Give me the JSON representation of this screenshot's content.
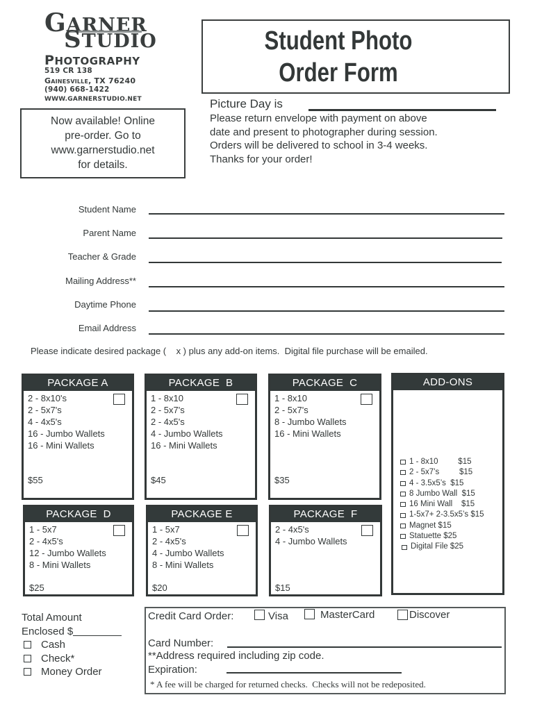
{
  "logo": {
    "line1_initial": "G",
    "line1_rest": "ARNER",
    "line2_initial": "S",
    "line2_rest": "TUDIO",
    "line3_initial": "P",
    "line3_rest": "HOTOGRAPHY",
    "address": "519 CR 138",
    "city": "Gainesville, TX 76240",
    "phone": "(940) 668-1422",
    "website": "www.garnerstudio.net"
  },
  "title": {
    "line1": "Student Photo",
    "line2": "Order Form"
  },
  "picture_day": {
    "label": "Picture Day is",
    "value": ""
  },
  "instructions": [
    "Please return envelope with payment on above",
    "date and present to photographer during session.",
    "Orders will be delivered to school in 3-4 weeks.",
    "Thanks for your order!"
  ],
  "online_notice": [
    "Now available!  Online",
    "pre-order.  Go to",
    "www.garnerstudio.net",
    "for details."
  ],
  "fields": [
    {
      "label": "Student Name",
      "value": ""
    },
    {
      "label": "Parent Name",
      "value": ""
    },
    {
      "label": "Teacher & Grade",
      "value": ""
    },
    {
      "label": "Mailing Address**",
      "value": ""
    },
    {
      "label": "Daytime Phone",
      "value": ""
    },
    {
      "label": "Email Address",
      "value": ""
    }
  ],
  "package_instruction": "Please indicate desired package (    x ) plus any add-on items.  Digital file purchase will be emailed.",
  "packages": [
    {
      "name": "PACKAGE A",
      "items": [
        "2 - 8x10's",
        "2 - 5x7's",
        "4 - 4x5's",
        "16 - Jumbo Wallets",
        "16 - Mini Wallets"
      ],
      "price": "$55",
      "checked": false
    },
    {
      "name": "PACKAGE  B",
      "items": [
        "1 - 8x10",
        "2 - 5x7's",
        "2 - 4x5's",
        "4 - Jumbo Wallets",
        "16 - Mini Wallets"
      ],
      "price": "$45",
      "checked": false
    },
    {
      "name": "PACKAGE  C",
      "items": [
        "1 - 8x10",
        "2 - 5x7's",
        "8 - Jumbo Wallets",
        "16 - Mini Wallets"
      ],
      "price": "$35",
      "checked": false
    },
    {
      "name": "PACKAGE  D",
      "items": [
        "1 - 5x7",
        "2 - 4x5's",
        "12 - Jumbo Wallets",
        "8 - Mini Wallets"
      ],
      "price": "$25",
      "checked": false
    },
    {
      "name": "PACKAGE E",
      "items": [
        "1 - 5x7",
        "2 - 4x5's",
        "4 - Jumbo Wallets",
        "8 - Mini Wallets"
      ],
      "price": "$20",
      "checked": false
    },
    {
      "name": "PACKAGE  F",
      "items": [
        "2 - 4x5's",
        "4 - Jumbo Wallets"
      ],
      "price": "$15",
      "checked": false
    }
  ],
  "addons": {
    "title": "ADD-ONS",
    "items": [
      {
        "label": "1 - 8x10         $15",
        "checked": false
      },
      {
        "label": "2 - 5x7’s         $15",
        "checked": false
      },
      {
        "label": "4 - 3.5x5’s  $15",
        "checked": false
      },
      {
        "label": "8 Jumbo Wall  $15",
        "checked": false
      },
      {
        "label": "16 Mini Wall    $15",
        "checked": false
      },
      {
        "label": "1-5x7+ 2-3.5x5’s $15",
        "checked": false
      },
      {
        "label": "Magnet $15",
        "checked": false
      },
      {
        "label": "Statuette $25",
        "checked": false
      },
      {
        "label": "Digital File $25",
        "checked": false
      }
    ]
  },
  "payment": {
    "total_label_1": "Total Amount",
    "total_label_2": "Enclosed $",
    "total_value": "",
    "options": [
      {
        "label": "Cash",
        "checked": false
      },
      {
        "label": "Check*",
        "checked": false
      },
      {
        "label": "Money Order",
        "checked": false
      }
    ]
  },
  "credit_card": {
    "label": "Credit Card Order:",
    "cards": [
      {
        "label": "Visa",
        "checked": false
      },
      {
        "label": "MasterCard",
        "checked": false
      },
      {
        "label": "Discover",
        "checked": false
      }
    ],
    "card_number_label": "Card Number:",
    "card_number_value": "",
    "address_note": "**Address required including zip code.",
    "expiration_label": "Expiration:",
    "expiration_value": "",
    "fee_note": "* A fee will be charged for returned checks.  Checks will not be redeposited."
  }
}
